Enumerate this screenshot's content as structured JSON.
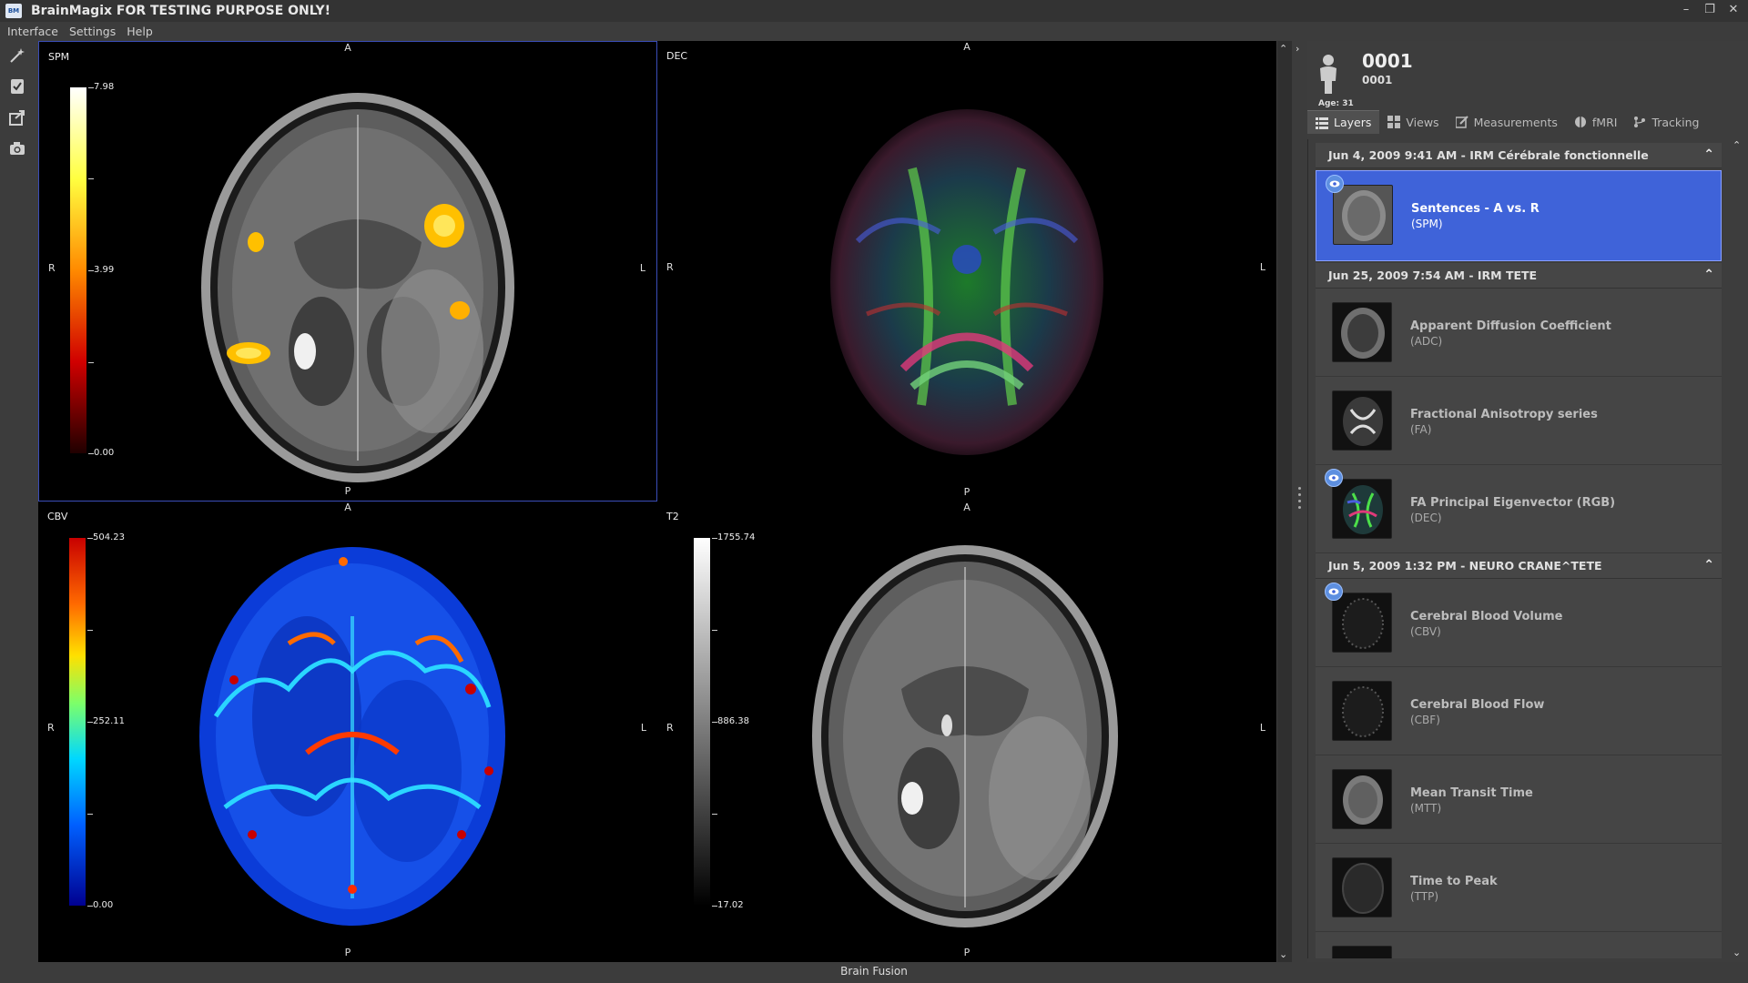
{
  "app": {
    "title": "BrainMagix FOR TESTING PURPOSE ONLY!",
    "logo_text": "BM",
    "window_controls": [
      "–",
      "❐",
      "✕"
    ]
  },
  "menu": [
    "Interface",
    "Settings",
    "Help"
  ],
  "toolbar": {
    "icons": [
      "magic-wand-icon",
      "checklist-icon",
      "export-icon",
      "camera-icon"
    ]
  },
  "viewer": {
    "orientation": {
      "anterior": "A",
      "posterior": "P",
      "right": "R",
      "left": "L"
    },
    "panes": [
      {
        "label": "SPM",
        "colorbar": {
          "max": "7.98",
          "mid": "3.99",
          "min": "0.00"
        }
      },
      {
        "label": "DEC"
      },
      {
        "label": "CBV",
        "colorbar": {
          "max": "504.23",
          "mid": "252.11",
          "min": "0.00"
        }
      },
      {
        "label": "T2",
        "colorbar": {
          "max": "1755.74",
          "mid": "886.38",
          "min": "17.02"
        }
      }
    ]
  },
  "patient": {
    "id": "0001",
    "sub_id": "0001",
    "age": "Age: 31"
  },
  "tabs": [
    {
      "label": "Layers",
      "icon": "list-icon",
      "active": true
    },
    {
      "label": "Views",
      "icon": "grid-icon",
      "active": false
    },
    {
      "label": "Measurements",
      "icon": "edit-icon",
      "active": false
    },
    {
      "label": "fMRI",
      "icon": "brain-icon",
      "active": false
    },
    {
      "label": "Tracking",
      "icon": "tracking-icon",
      "active": false
    }
  ],
  "groups": [
    {
      "header": "Jun 4, 2009 9:41 AM - IRM Cérébrale fonctionnelle",
      "layers": [
        {
          "name": "Sentences - A vs. R",
          "abbr": "(SPM)",
          "visible": true,
          "selected": true
        }
      ]
    },
    {
      "header": "Jun 25, 2009 7:54 AM - IRM TETE",
      "layers": [
        {
          "name": "Apparent Diffusion Coefficient",
          "abbr": "(ADC)",
          "visible": false,
          "selected": false
        },
        {
          "name": "Fractional Anisotropy series",
          "abbr": "(FA)",
          "visible": false,
          "selected": false
        },
        {
          "name": "FA Principal Eigenvector (RGB)",
          "abbr": "(DEC)",
          "visible": true,
          "selected": false
        }
      ]
    },
    {
      "header": "Jun 5, 2009 1:32 PM - NEURO CRANE^TETE",
      "layers": [
        {
          "name": "Cerebral Blood Volume",
          "abbr": "(CBV)",
          "visible": true,
          "selected": false
        },
        {
          "name": "Cerebral Blood Flow",
          "abbr": "(CBF)",
          "visible": false,
          "selected": false
        },
        {
          "name": "Mean Transit Time",
          "abbr": "(MTT)",
          "visible": false,
          "selected": false
        },
        {
          "name": "Time to Peak",
          "abbr": "(TTP)",
          "visible": false,
          "selected": false
        }
      ]
    }
  ],
  "status": "Brain Fusion",
  "colors": {
    "selection": "#3f63d9",
    "eye": "#5d8fe0",
    "background": "#3c3c3c"
  }
}
